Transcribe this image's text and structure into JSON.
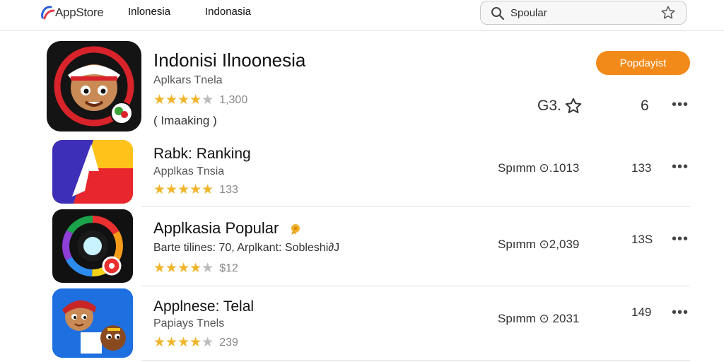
{
  "header": {
    "logo_text": "AppStore",
    "nav": [
      "Inlonesia",
      "Indonasia"
    ],
    "search_placeholder": "Spoular"
  },
  "featured": {
    "title": "Indonisi Ilnoonesia",
    "subtitle": "Aplkars Tnela",
    "rating_count": "1,300",
    "tag": "( Imaaking )",
    "button_label": "Popdayist",
    "score": "G3.",
    "number": "6",
    "more": "•••"
  },
  "apps": [
    {
      "title": "Rabk: Ranking",
      "subtitle": "Applkas Tnsia",
      "rating_count": "133",
      "stat": "Spımm ⊙.1013",
      "number": "133",
      "more": "•••"
    },
    {
      "title": "Applkasia Popular",
      "subtitle": "Barte tilines: 70, Arplkant: Sobleshi∂J",
      "rating_count": "$12",
      "stat": "Spımm ⊙2,039",
      "number": "13S",
      "more": "•••"
    },
    {
      "title": "Applnese: Telal",
      "subtitle": "Papiays Tnels",
      "rating_count": "239",
      "stat": "Spımm ⊙ 2031",
      "number": "149",
      "more": "•••"
    }
  ],
  "colors": {
    "accent_orange": "#f28a1a",
    "star_yellow": "#f0b429"
  }
}
